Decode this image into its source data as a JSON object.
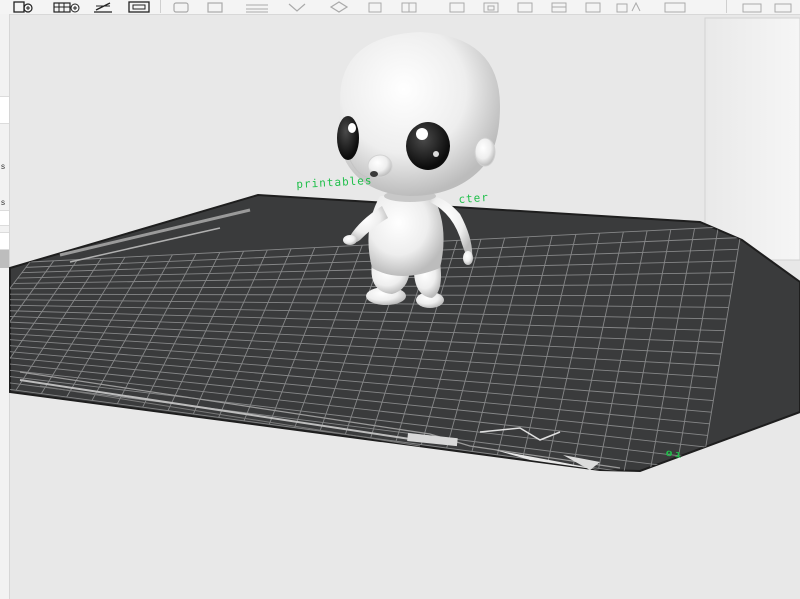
{
  "toolbar": {
    "buttons": [
      {
        "name": "add-object-button",
        "icon": "add-cube-icon"
      },
      {
        "name": "add-plate-button",
        "icon": "grid-add-icon"
      },
      {
        "name": "orient-button",
        "icon": "orient-icon"
      },
      {
        "name": "arrange-button",
        "icon": "arrange-icon"
      },
      {
        "name": "split-button",
        "icon": "split-icon"
      },
      {
        "name": "move-button",
        "icon": "move-icon"
      },
      {
        "name": "rotate-button",
        "icon": "rotate-icon"
      },
      {
        "name": "scale-button",
        "icon": "scale-icon"
      },
      {
        "name": "cut-button",
        "icon": "cut-icon"
      },
      {
        "name": "support-paint-button",
        "icon": "brush-icon"
      },
      {
        "name": "seam-paint-button",
        "icon": "seam-icon"
      },
      {
        "name": "text-button",
        "icon": "text-icon"
      },
      {
        "name": "measure-button",
        "icon": "ruler-icon"
      },
      {
        "name": "view-button",
        "icon": "view-icon"
      }
    ]
  },
  "scene": {
    "bed_caption_left": "printables",
    "bed_caption_right": "cter",
    "bed_id": "01",
    "accent_color": "#1fbf4a",
    "bed_color": "#3a3b3c",
    "grid_color": "#8a8b8c",
    "model": "white-character-figure"
  }
}
